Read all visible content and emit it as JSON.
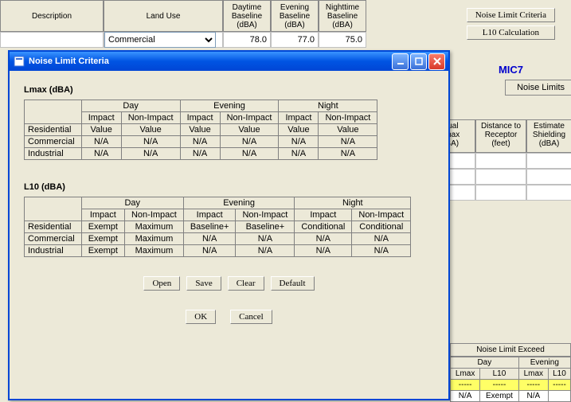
{
  "bg": {
    "headers": {
      "description": "Description",
      "land_use": "Land Use",
      "daytime": "Daytime\nBaseline\n(dBA)",
      "evening": "Evening\nBaseline\n(dBA)",
      "nighttime": "Nighttime\nBaseline\n(dBA)"
    },
    "row": {
      "description": "",
      "land_use_selected": "Commercial",
      "daytime": "78.0",
      "evening": "77.0",
      "nighttime": "75.0"
    },
    "right_buttons": {
      "noise_limit": "Noise Limit Criteria",
      "l10_calc": "L10 Calculation"
    },
    "mic_label": "MIC7",
    "tab_label": "Noise Limits",
    "far_right_headers": [
      "ctual\nLmax\ndBA)",
      "Distance to\nReceptor\n(feet)",
      "Estimate\nShielding\n(dBA)"
    ],
    "bottom": {
      "title": "Noise Limit Exceed",
      "group_day": "Day",
      "group_evening": "Evening",
      "cols": [
        "Lmax",
        "L10",
        "Lmax",
        "L10"
      ],
      "row_yellow": [
        "-----",
        "-----",
        "-----",
        "-----"
      ],
      "row_white": [
        "N/A",
        "Exempt",
        "N/A",
        ""
      ]
    }
  },
  "dialog": {
    "title": "Noise Limit Criteria",
    "lmax_title": "Lmax (dBA)",
    "l10_title": "L10 (dBA)",
    "group_headers": [
      "Day",
      "Evening",
      "Night"
    ],
    "sub_headers": [
      "Impact",
      "Non-Impact"
    ],
    "row_labels": [
      "Residential",
      "Commercial",
      "Industrial"
    ],
    "lmax_rows": [
      [
        "Value",
        "Value",
        "Value",
        "Value",
        "Value",
        "Value"
      ],
      [
        "N/A",
        "N/A",
        "N/A",
        "N/A",
        "N/A",
        "N/A"
      ],
      [
        "N/A",
        "N/A",
        "N/A",
        "N/A",
        "N/A",
        "N/A"
      ]
    ],
    "l10_rows": [
      [
        "Exempt",
        "Maximum",
        "Baseline+",
        "Baseline+",
        "Conditional",
        "Conditional"
      ],
      [
        "Exempt",
        "Maximum",
        "N/A",
        "N/A",
        "N/A",
        "N/A"
      ],
      [
        "Exempt",
        "Maximum",
        "N/A",
        "N/A",
        "N/A",
        "N/A"
      ]
    ],
    "buttons": {
      "open": "Open",
      "save": "Save",
      "clear": "Clear",
      "default": "Default",
      "ok": "OK",
      "cancel": "Cancel"
    }
  }
}
